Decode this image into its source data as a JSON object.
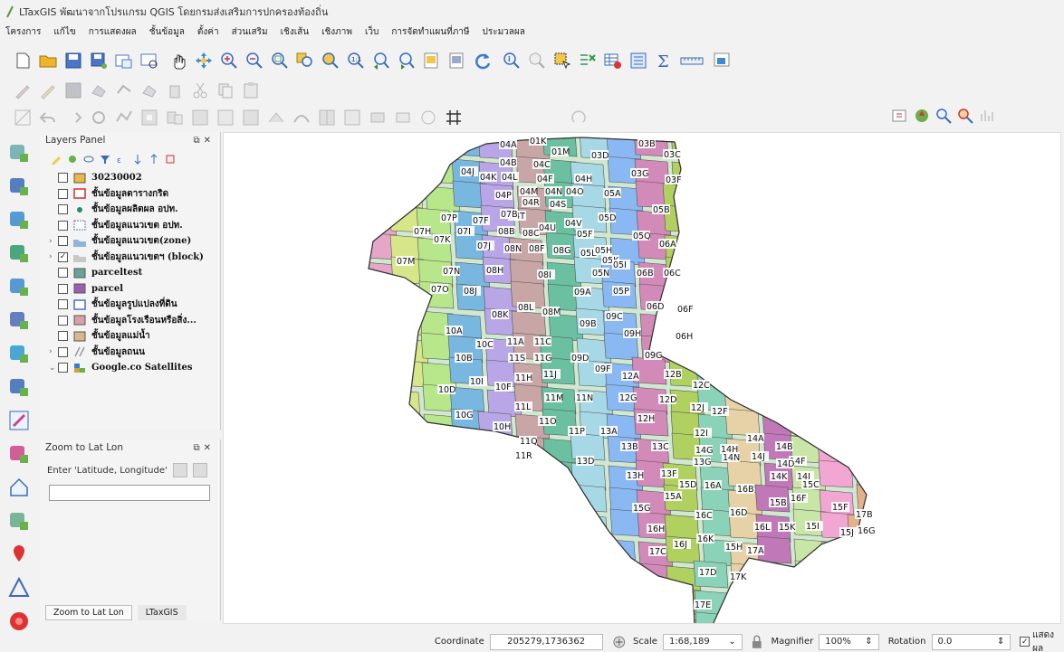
{
  "window": {
    "title": "LTaxGIS พัฒนาจากโปรแกรม QGIS โดยกรมส่งเสริมการปกครองท้องถิ่น"
  },
  "menubar": {
    "items": [
      "โครงการ",
      "แก้ไข",
      "การแสดงผล",
      "ชั้นข้อมูล",
      "ตั้งค่า",
      "ส่วนเสริม",
      "เชิงเส้น",
      "เชิงภาพ",
      "เว็บ",
      "การจัดทำแผนที่ภาษี",
      "ประมวลผล"
    ]
  },
  "icons": {
    "toolbar_main": [
      "new-project-icon",
      "open-project-icon",
      "save-project-icon",
      "save-as-icon",
      "new-print-layout-icon",
      "layout-manager-icon",
      "pan-icon",
      "pan-to-selection-icon",
      "zoom-in-icon",
      "zoom-out-icon",
      "zoom-full-icon",
      "zoom-to-selection-icon",
      "zoom-to-layer-icon",
      "zoom-native-icon",
      "zoom-last-icon",
      "zoom-next-icon",
      "new-map-view-icon",
      "new-3d-view-icon",
      "refresh-icon",
      "identify-icon",
      "run-action-icon",
      "select-features-icon",
      "deselect-icon",
      "open-attribute-table-icon",
      "statistics-icon",
      "measure-icon",
      "map-tips-icon"
    ],
    "left_toolbar": [
      "add-vector-layer-icon",
      "add-raster-layer-icon",
      "add-delimited-text-icon",
      "add-wms-icon",
      "add-wfs-icon",
      "add-postgis-icon",
      "add-spatialite-icon",
      "add-virtual-layer-icon",
      "edit-pencil-icon",
      "ltax-map-icon",
      "home-icon",
      "attribute-form-icon",
      "pin-marker-icon",
      "triangle-tool-icon",
      "red-circle-icon"
    ],
    "corner": [
      "pin-layer-icon",
      "globe-marker-icon",
      "zoom-lens-icon",
      "multi-zoom-icon",
      "chart-icon"
    ]
  },
  "layers_panel": {
    "title": "Layers Panel",
    "layers": [
      {
        "label": "30230002",
        "symbol": "fill",
        "color": "#e8b84a",
        "checked": false,
        "expand": ""
      },
      {
        "label": "ชั้นข้อมูลตารางกริด",
        "symbol": "outline",
        "color": "#d32f2f",
        "checked": false,
        "expand": ""
      },
      {
        "label": "ชั้นข้อมูลผลิตผล อปท.",
        "symbol": "point",
        "color": "#2a8a6e",
        "checked": false,
        "expand": ""
      },
      {
        "label": "ชั้นข้อมูลแนวเขต อปท.",
        "symbol": "dashed",
        "color": "#5a6ec8",
        "checked": false,
        "expand": ""
      },
      {
        "label": "ชั้นข้อมูลแนวเขต(zone)",
        "symbol": "group",
        "color": "#8fb5d9",
        "checked": false,
        "expand": "›"
      },
      {
        "label": "ชั้นข้อมูลแนวเขตฯ (block)",
        "symbol": "group",
        "color": "#c8c8c8",
        "checked": true,
        "expand": "›"
      },
      {
        "label": "parceltest",
        "symbol": "fill",
        "color": "#6aa39a",
        "checked": false,
        "expand": ""
      },
      {
        "label": "parcel",
        "symbol": "fill",
        "color": "#9a5fb0",
        "checked": false,
        "expand": ""
      },
      {
        "label": "ชั้นข้อมูลรูปแปลงที่ดิน",
        "symbol": "outline",
        "color": "#4a72b8",
        "checked": false,
        "expand": ""
      },
      {
        "label": "ชั้นข้อมูลโรงเรือนหรือสิ่ง...",
        "symbol": "fill",
        "color": "#d9a0a8",
        "checked": false,
        "expand": ""
      },
      {
        "label": "ชั้นข้อมูลแม่น้ำ",
        "symbol": "fill",
        "color": "#d6b88c",
        "checked": false,
        "expand": ""
      },
      {
        "label": "ชั้นข้อมูลถนน",
        "symbol": "road",
        "color": "#999999",
        "checked": false,
        "expand": "›"
      },
      {
        "label": "Google.co Satellites",
        "symbol": "raster",
        "color": "#3a7ad0",
        "checked": false,
        "expand": "⌄"
      }
    ]
  },
  "zoom_panel": {
    "title": "Zoom to Lat Lon",
    "prompt": "Enter 'Latitude, Longitude'",
    "input_value": ""
  },
  "bottom_tabs": [
    "Zoom to Lat Lon",
    "LTaxGIS"
  ],
  "map": {
    "labels": [
      "04A",
      "01K",
      "03B",
      "03C",
      "01M",
      "03D",
      "04B",
      "04C",
      "04J",
      "04K",
      "04L",
      "04F",
      "04H",
      "03G",
      "03F",
      "04P",
      "04M",
      "04N",
      "04O",
      "05A",
      "04R",
      "04S",
      "04T",
      "05B",
      "07P",
      "07F",
      "07B",
      "04U",
      "04V",
      "05D",
      "07H",
      "07K",
      "07I",
      "08B",
      "08C",
      "05F",
      "05Q",
      "06A",
      "07J",
      "08N",
      "08F",
      "08G",
      "05L",
      "05H",
      "05K",
      "05I",
      "07M",
      "07N",
      "08H",
      "05N",
      "06B",
      "06C",
      "08I",
      "05P",
      "07O",
      "08J",
      "09A",
      "06D",
      "06F",
      "08K",
      "08L",
      "08M",
      "09B",
      "09C",
      "10A",
      "06H",
      "09H",
      "10C",
      "11A",
      "11C",
      "10B",
      "11S",
      "11G",
      "09D",
      "09G",
      "09F",
      "11J",
      "12A",
      "12B",
      "12C",
      "10I",
      "10F",
      "11H",
      "10D",
      "11M",
      "11N",
      "12G",
      "12D",
      "12J",
      "12F",
      "11L",
      "10G",
      "11O",
      "12H",
      "10H",
      "11P",
      "13A",
      "12I",
      "14A",
      "14B",
      "11Q",
      "13B",
      "13C",
      "14G",
      "14H",
      "14J",
      "14F",
      "14D",
      "11R",
      "13D",
      "13H",
      "13F",
      "13G",
      "14N",
      "14K",
      "14I",
      "15C",
      "15D",
      "16A",
      "16B",
      "15B",
      "16F",
      "15A",
      "15F",
      "15G",
      "16C",
      "16D",
      "16L",
      "15K",
      "15I",
      "15J",
      "16G",
      "16H",
      "16J",
      "16K",
      "15H",
      "17A",
      "17B",
      "17C",
      "17D",
      "17K",
      "17E"
    ]
  },
  "statusbar": {
    "coordinate_label": "Coordinate",
    "coordinate_value": "205279,1736362",
    "scale_label": "Scale",
    "scale_value": "1:68,189",
    "magnifier_label": "Magnifier",
    "magnifier_value": "100%",
    "rotation_label": "Rotation",
    "rotation_value": "0.0",
    "render_label": "แสดงผล",
    "render_checked": true
  }
}
